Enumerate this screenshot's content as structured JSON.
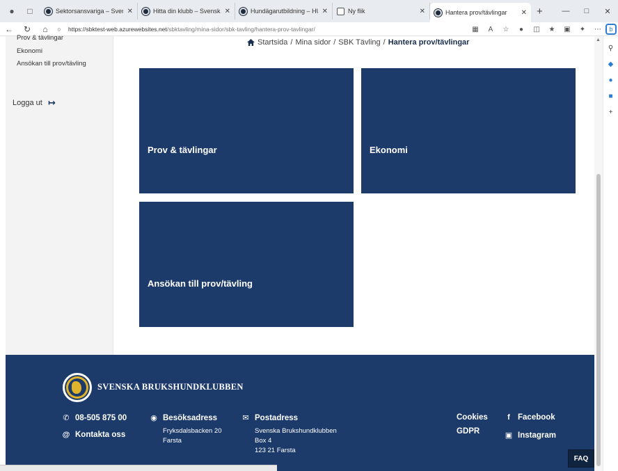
{
  "browser": {
    "tabs": [
      {
        "title": "Sektorsansvariga – Svenska Bruk"
      },
      {
        "title": "Hitta din klubb – Svenska Bruksh"
      },
      {
        "title": "Hundägarutbildning – HUS – Sve"
      },
      {
        "title": "Ny flik"
      },
      {
        "title": "Hantera prov/tävlingar"
      }
    ],
    "url_host": "https://sbktest-web.azurewebsites.net",
    "url_path": "/sbktavling/mina-sidor/sbk-tavling/hantera-prov-tavlingar/",
    "icons": [
      "profile-icon",
      "tab-actions-icon",
      "close-icon",
      "new-tab-icon",
      "back-icon",
      "refresh-icon",
      "home-icon",
      "lock-icon",
      "reader-icon",
      "read-aloud-icon",
      "favorite-icon",
      "extensions-icon",
      "split-screen-icon",
      "favorites-icon",
      "collections-icon",
      "copilot-icon",
      "more-icon"
    ]
  },
  "sidebar": {
    "items": [
      {
        "label": "Prov & tävlingar"
      },
      {
        "label": "Ekonomi"
      },
      {
        "label": "Ansökan till prov/tävling"
      }
    ],
    "logout_label": "Logga ut"
  },
  "breadcrumb": {
    "items": [
      "Startsida",
      "Mina sidor",
      "SBK Tävling"
    ],
    "separator": "/",
    "current": "Hantera prov/tävlingar"
  },
  "tiles": [
    {
      "label": "Prov & tävlingar"
    },
    {
      "label": "Ekonomi"
    },
    {
      "label": "Ansökan till prov/tävling"
    }
  ],
  "footer": {
    "brand": "SVENSKA BRUKSHUNDKLUBBEN",
    "phone": "08-505 875 00",
    "contact": "Kontakta oss",
    "visit_title": "Besöksadress",
    "visit_lines": [
      "Fryksdalsbacken 20",
      "Farsta"
    ],
    "post_title": "Postadress",
    "post_lines": [
      "Svenska Brukshundklubben",
      "Box 4",
      "123 21 Farsta"
    ],
    "cookies": "Cookies",
    "gdpr": "GDPR",
    "facebook": "Facebook",
    "instagram": "Instagram",
    "faq": "FAQ"
  },
  "colors": {
    "tile": "#1c3b6b",
    "footer": "#1c3b6b",
    "sidebar": "#f3f3f3",
    "accent_gold": "#e0b32c"
  }
}
